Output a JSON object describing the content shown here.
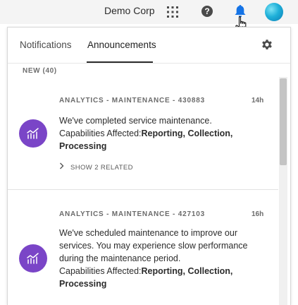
{
  "header": {
    "org_name": "Demo Corp",
    "icons": [
      "apps-grid-icon",
      "help-icon",
      "bell-icon",
      "avatar"
    ],
    "bell_color": "#1473e6"
  },
  "panel": {
    "tabs": [
      {
        "label": "Notifications",
        "active": false
      },
      {
        "label": "Announcements",
        "active": true
      }
    ],
    "section_label": "NEW (40)",
    "announcements": [
      {
        "title": "ANALYTICS - MAINTENANCE - 430883",
        "time": "14h",
        "body": "We've completed service maintenance.",
        "capabilities_label": "Capabilities Affected:",
        "capabilities": "Reporting, Collection, Processing",
        "related_label": "SHOW 2 RELATED"
      },
      {
        "title": "ANALYTICS - MAINTENANCE - 427103",
        "time": "16h",
        "body": "We've scheduled maintenance to improve our services. You may experience slow performance during the maintenance period.",
        "capabilities_label": "Capabilities Affected:",
        "capabilities": "Reporting, Collection, Processing"
      }
    ],
    "product_icon_color": "#7a45c7"
  }
}
